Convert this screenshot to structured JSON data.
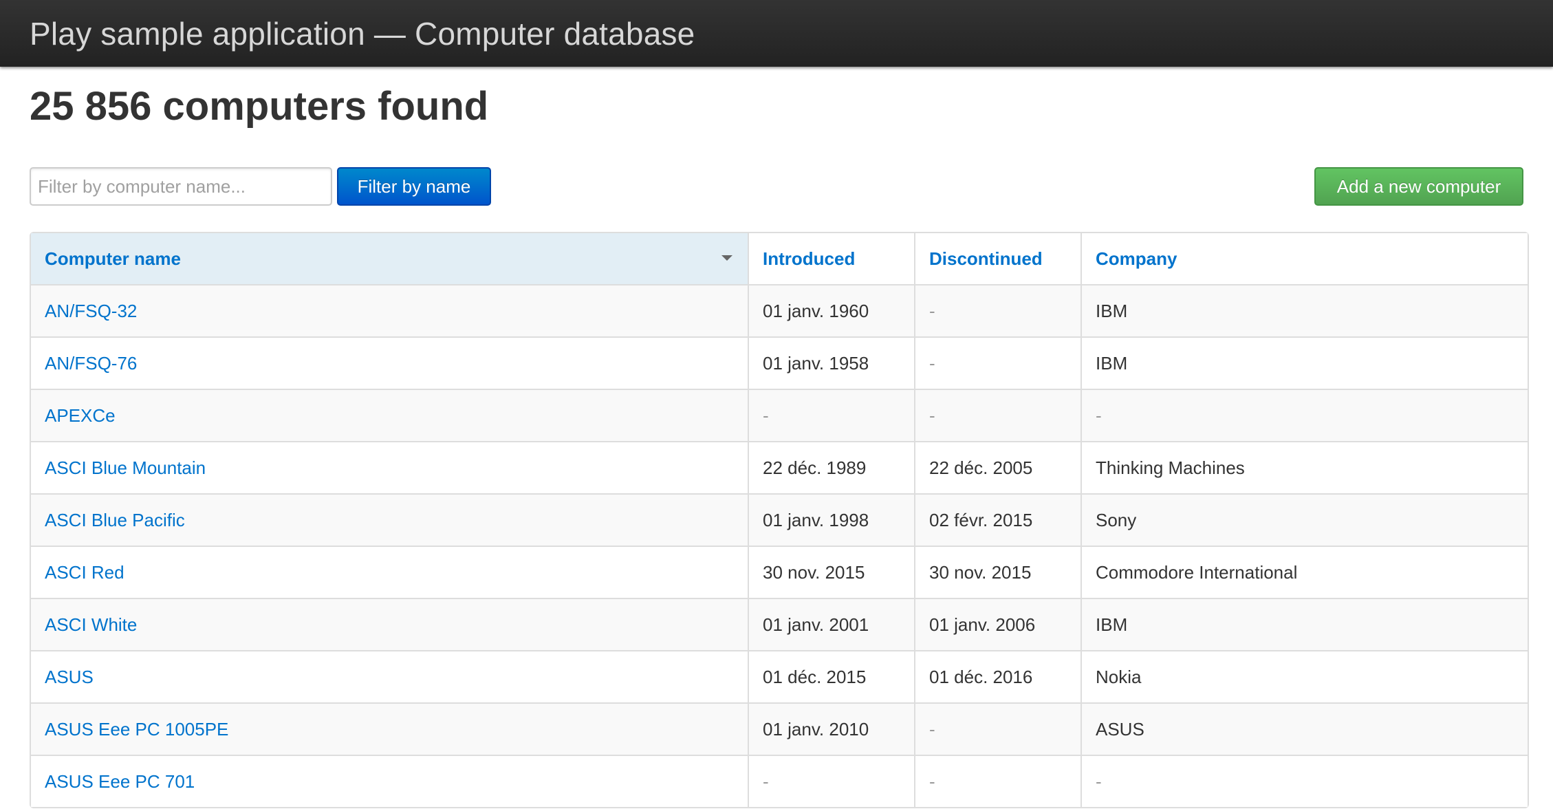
{
  "header": {
    "title": "Play sample application — Computer database"
  },
  "main": {
    "count_title": "25 856 computers found",
    "filter": {
      "placeholder": "Filter by computer name...",
      "value": ""
    },
    "filter_button_label": "Filter by name",
    "add_button_label": "Add a new computer"
  },
  "table": {
    "columns": {
      "name": "Computer name",
      "introduced": "Introduced",
      "discontinued": "Discontinued",
      "company": "Company"
    },
    "rows": [
      {
        "name": "AN/FSQ-32",
        "introduced": "01 janv. 1960",
        "discontinued": "-",
        "company": "IBM"
      },
      {
        "name": "AN/FSQ-76",
        "introduced": "01 janv. 1958",
        "discontinued": "-",
        "company": "IBM"
      },
      {
        "name": "APEXCe",
        "introduced": "-",
        "discontinued": "-",
        "company": "-"
      },
      {
        "name": "ASCI Blue Mountain",
        "introduced": "22 déc. 1989",
        "discontinued": "22 déc. 2005",
        "company": "Thinking Machines"
      },
      {
        "name": "ASCI Blue Pacific",
        "introduced": "01 janv. 1998",
        "discontinued": "02 févr. 2015",
        "company": "Sony"
      },
      {
        "name": "ASCI Red",
        "introduced": "30 nov. 2015",
        "discontinued": "30 nov. 2015",
        "company": "Commodore International"
      },
      {
        "name": "ASCI White",
        "introduced": "01 janv. 2001",
        "discontinued": "01 janv. 2006",
        "company": "IBM"
      },
      {
        "name": "ASUS",
        "introduced": "01 déc. 2015",
        "discontinued": "01 déc. 2016",
        "company": "Nokia"
      },
      {
        "name": "ASUS Eee PC 1005PE",
        "introduced": "01 janv. 2010",
        "discontinued": "-",
        "company": "ASUS"
      },
      {
        "name": "ASUS Eee PC 701",
        "introduced": "-",
        "discontinued": "-",
        "company": "-"
      }
    ]
  }
}
